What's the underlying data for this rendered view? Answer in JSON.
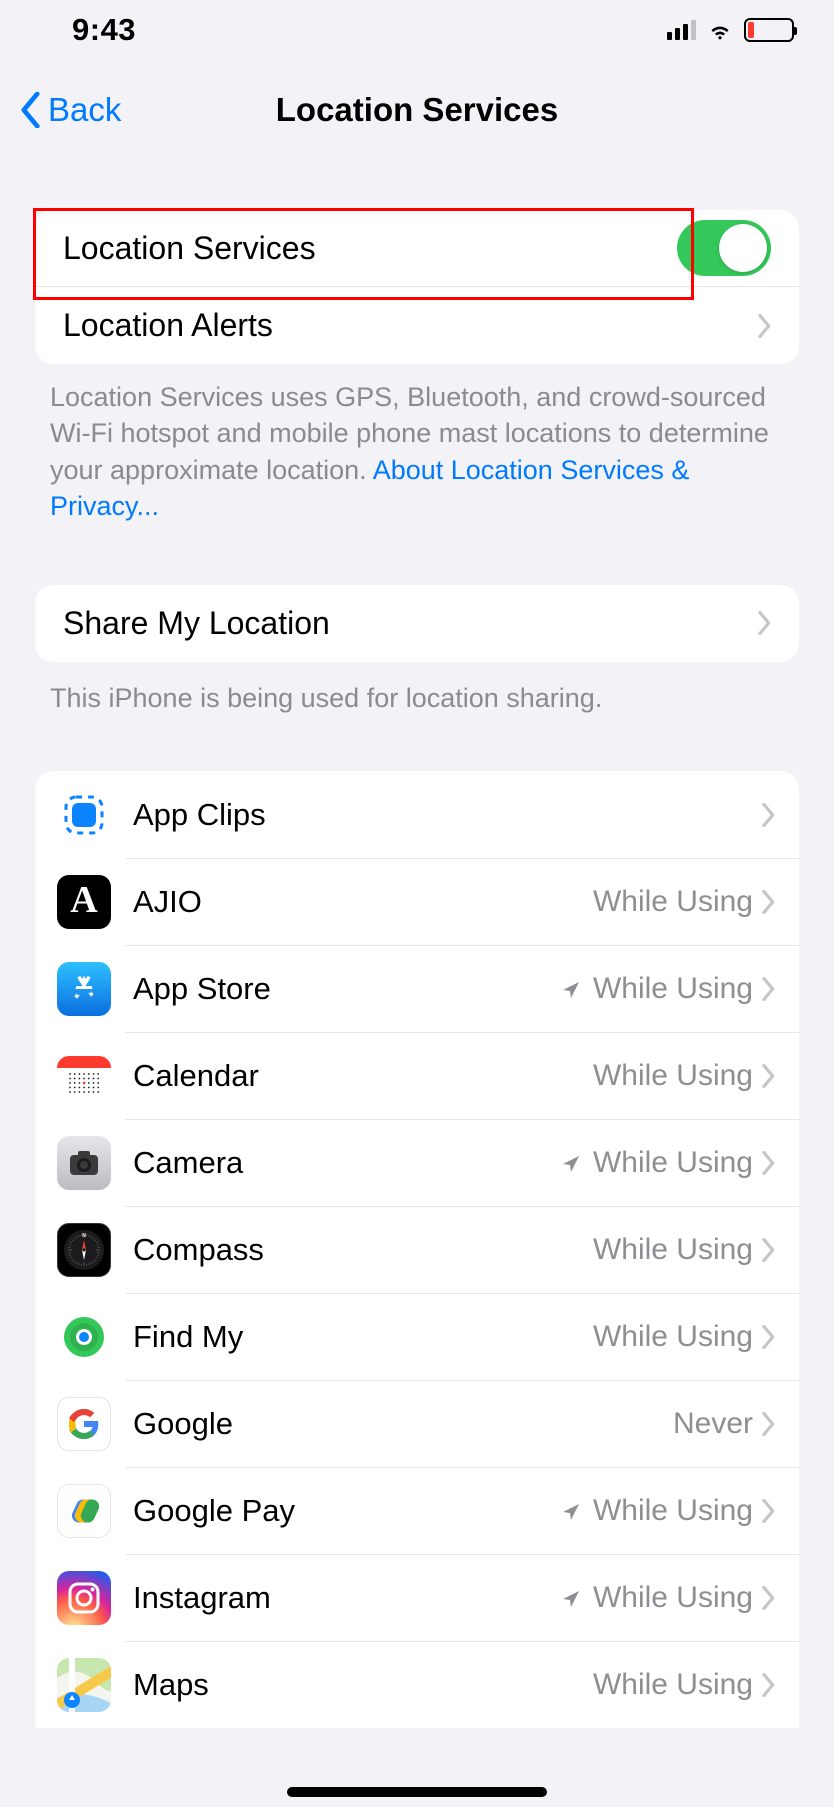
{
  "status": {
    "time": "9:43"
  },
  "nav": {
    "back": "Back",
    "title": "Location Services"
  },
  "section1": {
    "toggle_label": "Location Services",
    "toggle_on": true,
    "alerts_label": "Location Alerts"
  },
  "section1_footer": {
    "text": "Location Services uses GPS, Bluetooth, and crowd-sourced Wi-Fi hotspot and mobile phone mast locations to determine your approximate location. ",
    "link": "About Location Services & Privacy..."
  },
  "section2": {
    "share_label": "Share My Location",
    "footer": "This iPhone is being used for location sharing."
  },
  "apps": [
    {
      "name": "App Clips",
      "status": "",
      "arrow": false,
      "icon": "appclips"
    },
    {
      "name": "AJIO",
      "status": "While Using",
      "arrow": false,
      "icon": "ajio"
    },
    {
      "name": "App Store",
      "status": "While Using",
      "arrow": true,
      "icon": "appstore"
    },
    {
      "name": "Calendar",
      "status": "While Using",
      "arrow": false,
      "icon": "calendar"
    },
    {
      "name": "Camera",
      "status": "While Using",
      "arrow": true,
      "icon": "camera"
    },
    {
      "name": "Compass",
      "status": "While Using",
      "arrow": false,
      "icon": "compass"
    },
    {
      "name": "Find My",
      "status": "While Using",
      "arrow": false,
      "icon": "findmy"
    },
    {
      "name": "Google",
      "status": "Never",
      "arrow": false,
      "icon": "google"
    },
    {
      "name": "Google Pay",
      "status": "While Using",
      "arrow": true,
      "icon": "gpay"
    },
    {
      "name": "Instagram",
      "status": "While Using",
      "arrow": true,
      "icon": "instagram"
    },
    {
      "name": "Maps",
      "status": "While Using",
      "arrow": false,
      "icon": "maps"
    }
  ]
}
